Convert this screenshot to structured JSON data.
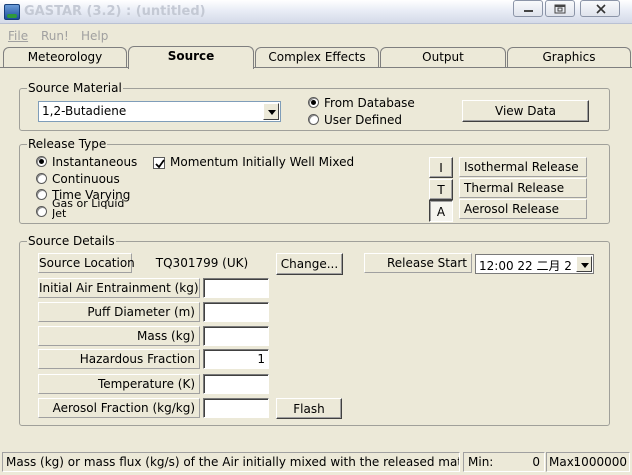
{
  "window": {
    "title": "GASTAR (3.2) : (untitled)",
    "controls": {
      "minimize_icon": "minimize-icon",
      "restore_icon": "restore-icon",
      "close_icon": "close-icon"
    }
  },
  "menu": [
    "File",
    "Run!",
    "Help"
  ],
  "tabs": [
    "Meteorology",
    "Source",
    "Complex Effects",
    "Output",
    "Graphics"
  ],
  "active_tab": "Source",
  "source_material": {
    "group_label": "Source Material",
    "material": "1,2-Butadiene",
    "options": [
      {
        "label": "From Database",
        "selected": true
      },
      {
        "label": "User Defined",
        "selected": false
      }
    ],
    "view_data_label": "View Data"
  },
  "release_type": {
    "group_label": "Release Type",
    "types": [
      {
        "label": "Instantaneous",
        "selected": true
      },
      {
        "label": "Continuous",
        "selected": false
      },
      {
        "label": "Time Varying",
        "selected": false
      },
      {
        "label": "Gas or Liquid Jet",
        "selected": false
      }
    ],
    "momentum_label": "Momentum Initially Well Mixed",
    "momentum_checked": true,
    "release_modes": [
      {
        "key": "I",
        "label": "Isothermal Release",
        "pressed": false
      },
      {
        "key": "T",
        "label": "Thermal Release",
        "pressed": false
      },
      {
        "key": "A",
        "label": "Aerosol Release",
        "pressed": true
      }
    ]
  },
  "source_details": {
    "group_label": "Source Details",
    "location_label": "Source Location",
    "location_value": "TQ301799 (UK)",
    "change_label": "Change...",
    "release_start_label": "Release Start",
    "release_start_value": "12:00 22  二月  2",
    "fields": [
      {
        "label": "Initial Air Entrainment (kg)",
        "value": ""
      },
      {
        "label": "Puff Diameter (m)",
        "value": ""
      },
      {
        "label": "Mass (kg)",
        "value": ""
      },
      {
        "label": "Hazardous Fraction",
        "value": "1"
      },
      {
        "label": "Temperature (K)",
        "value": ""
      },
      {
        "label": "Aerosol Fraction (kg/kg)",
        "value": ""
      }
    ],
    "flash_label": "Flash"
  },
  "status": {
    "message": "Mass (kg) or mass flux (kg/s) of the Air initially mixed with the released material",
    "min_label": "Min:",
    "min_value": "0",
    "max_label": "Max:",
    "max_value": "1000000"
  }
}
